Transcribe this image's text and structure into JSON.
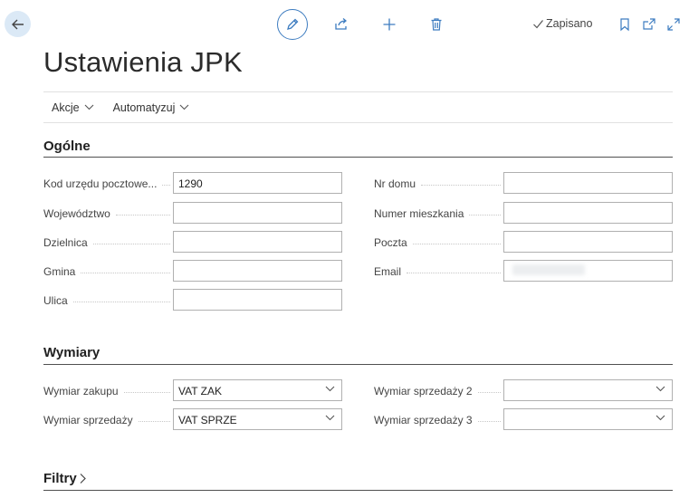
{
  "header": {
    "saved_label": "Zapisano"
  },
  "page": {
    "title": "Ustawienia JPK"
  },
  "actions": [
    {
      "label": "Akcje"
    },
    {
      "label": "Automatyzuj"
    }
  ],
  "sections": {
    "general": {
      "title": "Ogólne",
      "left_fields": [
        {
          "label": "Kod urzędu pocztowe...",
          "value": "1290"
        },
        {
          "label": "Województwo",
          "value": ""
        },
        {
          "label": "Dzielnica",
          "value": ""
        },
        {
          "label": "Gmina",
          "value": ""
        },
        {
          "label": "Ulica",
          "value": ""
        }
      ],
      "right_fields": [
        {
          "label": "Nr domu",
          "value": ""
        },
        {
          "label": "Numer mieszkania",
          "value": ""
        },
        {
          "label": "Poczta",
          "value": ""
        },
        {
          "label": "Email",
          "value": ""
        }
      ]
    },
    "dimensions": {
      "title": "Wymiary",
      "left_fields": [
        {
          "label": "Wymiar zakupu",
          "value": "VAT ZAK"
        },
        {
          "label": "Wymiar sprzedaży",
          "value": "VAT SPRZE"
        }
      ],
      "right_fields": [
        {
          "label": "Wymiar sprzedaży 2",
          "value": ""
        },
        {
          "label": "Wymiar sprzedaży 3",
          "value": ""
        }
      ]
    },
    "filters": {
      "title": "Filtry"
    }
  },
  "colors": {
    "accent": "#3d7cc0",
    "back_button_bg": "#dbe9f6"
  }
}
